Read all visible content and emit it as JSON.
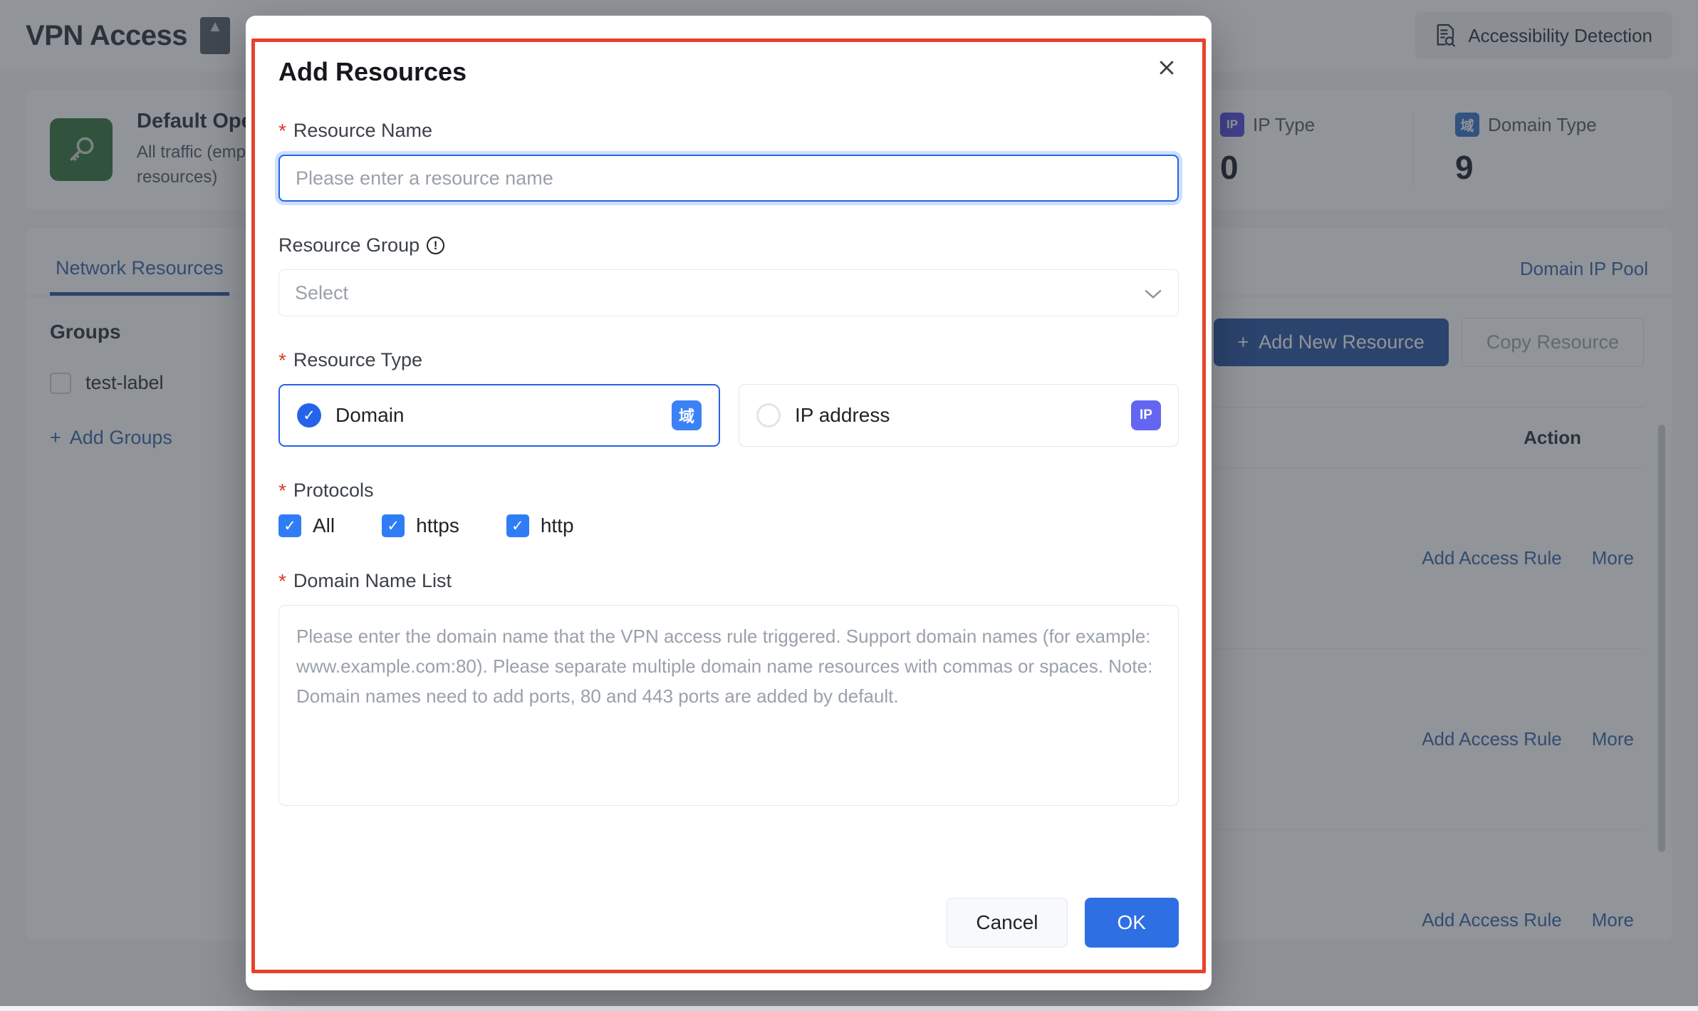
{
  "page": {
    "title": "VPN Access",
    "header_icon": "document-icon",
    "accessibility_button": "Accessibility Detection",
    "accessibility_icon": "doc-search-icon",
    "summary": {
      "key_icon": "key-icon",
      "name": "Default Open",
      "description": "All traffic (employees and network resources)",
      "stats": [
        {
          "icon": "ip-badge-icon",
          "label": "IP Type",
          "value": "0"
        },
        {
          "icon": "domain-badge-icon",
          "label": "Domain Type",
          "value": "9"
        }
      ]
    },
    "tabs": [
      {
        "label": "Network Resources",
        "active": true
      }
    ],
    "tab_right_link": "Domain IP Pool",
    "groups": {
      "title": "Groups",
      "items": [
        {
          "label": "test-label",
          "checked": false
        }
      ],
      "add_label": "Add Groups",
      "add_icon": "plus-icon"
    },
    "toolbar": {
      "collapse_icon": "chevron-up-icon",
      "add_resource_label": "Add New Resource",
      "add_resource_icon": "plus-icon",
      "copy_resource_label": "Copy Resource"
    },
    "table": {
      "columns": [
        "Action"
      ],
      "rows": [
        {
          "add_rule": "Add Access Rule",
          "more": "More"
        },
        {
          "add_rule": "Add Access Rule",
          "more": "More"
        },
        {
          "add_rule": "Add Access Rule",
          "more": "More"
        }
      ]
    }
  },
  "modal": {
    "title": "Add Resources",
    "close_icon": "close-icon",
    "resource_name": {
      "label": "Resource Name",
      "required": true,
      "value": "",
      "placeholder": "Please enter a resource name"
    },
    "resource_group": {
      "label": "Resource Group",
      "required": false,
      "info_icon": "info-icon",
      "value": "",
      "placeholder": "Select",
      "chevron_icon": "chevron-down-icon"
    },
    "resource_type": {
      "label": "Resource Type",
      "required": true,
      "options": [
        {
          "label": "Domain",
          "selected": true,
          "badge": "域",
          "badge_icon": "domain-badge-icon"
        },
        {
          "label": "IP address",
          "selected": false,
          "badge": "IP",
          "badge_icon": "ip-badge-icon"
        }
      ]
    },
    "protocols": {
      "label": "Protocols",
      "required": true,
      "options": [
        {
          "label": "All",
          "checked": true
        },
        {
          "label": "https",
          "checked": true
        },
        {
          "label": "http",
          "checked": true
        }
      ]
    },
    "domain_name_list": {
      "label": "Domain Name List",
      "required": true,
      "value": "",
      "placeholder": "Please enter the domain name that the VPN access rule triggered. Support domain names (for example: www.example.com:80). Please separate multiple domain name resources with commas or spaces. Note: Domain names need to add ports, 80 and 443 ports are added by default."
    },
    "cancel_label": "Cancel",
    "ok_label": "OK"
  },
  "colors": {
    "accent_blue": "#2f6fe4",
    "highlight_red": "#e8422a",
    "required_red": "#e0352b",
    "link_blue": "#2d5fa8",
    "primary_dark_blue": "#1e4fa0",
    "key_green": "#2b6e36",
    "badge_indigo": "#6366f1",
    "badge_blue": "#3b82f6"
  }
}
